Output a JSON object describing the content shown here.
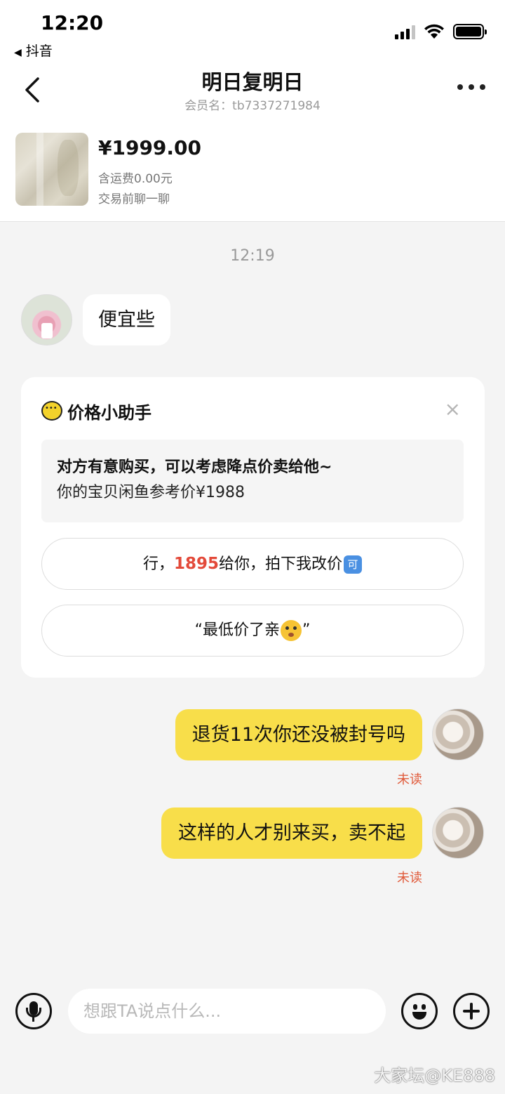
{
  "status_bar": {
    "time": "12:20",
    "back_app": "抖音",
    "battery_level": 1.0,
    "signal_bars": 3
  },
  "header": {
    "title": "明日复明日",
    "subtitle": "会员名：tb7337271984"
  },
  "product": {
    "price": "¥1999.00",
    "shipping": "含运费0.00元",
    "hint": "交易前聊一聊"
  },
  "chat": {
    "timestamp": "12:19",
    "incoming_message": "便宜些",
    "outgoing_messages": [
      {
        "text": "退货11次你还没被封号吗",
        "status": "未读"
      },
      {
        "text": "这样的人才别来买，卖不起",
        "status": "未读"
      }
    ]
  },
  "price_helper": {
    "title": "价格小助手",
    "close": "×",
    "message_line1": "对方有意购买，可以考虑降点价卖给他~",
    "message_line2": "你的宝贝闲鱼参考价¥1988",
    "option1_prefix": "行，",
    "option1_price": "1895",
    "option1_suffix": "给你，拍下我改价",
    "option1_icon_text": "可",
    "option2_prefix": "“最低价了亲",
    "option2_suffix": "”"
  },
  "input": {
    "placeholder": "想跟TA说点什么..."
  },
  "watermark": "大家坛@KE888",
  "colors": {
    "accent_yellow": "#f8de4a",
    "price_red": "#e34a3a",
    "unread_red": "#e05a3a"
  }
}
